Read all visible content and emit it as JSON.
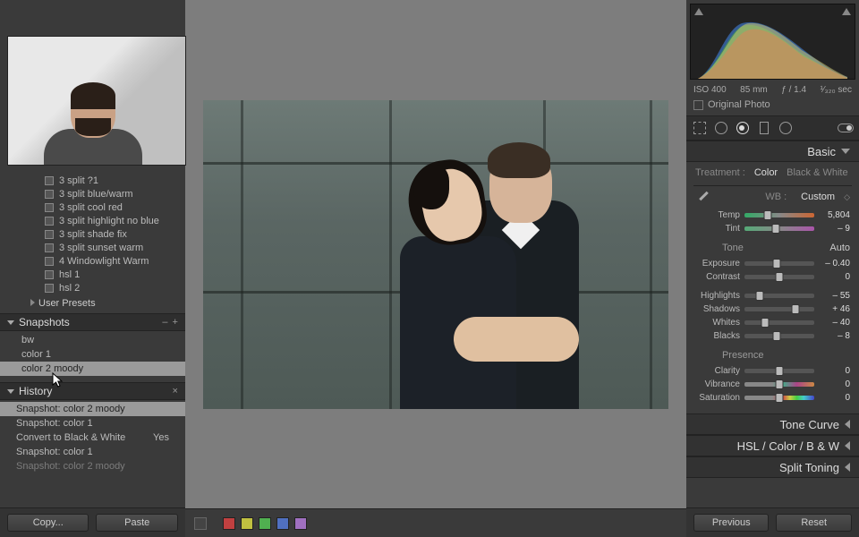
{
  "left": {
    "presets": [
      "3 split ?1",
      "3 split blue/warm",
      "3 split cool red",
      "3 split highlight no blue",
      "3 split shade fix",
      "3 split sunset warm",
      "4 Windowlight Warm",
      "hsl 1",
      "hsl 2"
    ],
    "userPresets": "User Presets",
    "snapshotsHeader": "Snapshots",
    "snapshots": [
      {
        "label": "bw",
        "selected": false
      },
      {
        "label": "color 1",
        "selected": false
      },
      {
        "label": "color 2 moody",
        "selected": true
      }
    ],
    "historyHeader": "History",
    "history": [
      {
        "label": "Snapshot: color 2 moody",
        "val": "",
        "selected": true
      },
      {
        "label": "Snapshot: color 1",
        "val": "",
        "selected": false
      },
      {
        "label": "Convert to Black & White",
        "val": "Yes",
        "selected": false
      },
      {
        "label": "Snapshot: color 1",
        "val": "",
        "selected": false
      },
      {
        "label": "Snapshot: color 2 moody",
        "val": "",
        "selected": false
      }
    ],
    "copy": "Copy...",
    "paste": "Paste"
  },
  "center": {
    "colors": [
      "#c04040",
      "#c0c040",
      "#50b050",
      "#50b0b0",
      "#5070c0",
      "#a070c0"
    ]
  },
  "right": {
    "exif": {
      "iso": "ISO 400",
      "fl": "85 mm",
      "ap": "ƒ / 1.4",
      "ss": "¹⁄₃₂₀ sec"
    },
    "originalPhoto": "Original Photo",
    "basic": "Basic",
    "treatment": {
      "label": "Treatment :",
      "color": "Color",
      "bw": "Black & White"
    },
    "wb": {
      "label": "WB :",
      "value": "Custom"
    },
    "temp": {
      "name": "Temp",
      "value": "5,804",
      "pos": 33
    },
    "tint": {
      "name": "Tint",
      "value": "– 9",
      "pos": 45
    },
    "toneHdr": "Tone",
    "autoLabel": "Auto",
    "exposure": {
      "name": "Exposure",
      "value": "– 0.40",
      "pos": 46
    },
    "contrast": {
      "name": "Contrast",
      "value": "0",
      "pos": 50
    },
    "highlights": {
      "name": "Highlights",
      "value": "– 55",
      "pos": 22
    },
    "shadows": {
      "name": "Shadows",
      "value": "+ 46",
      "pos": 73
    },
    "whites": {
      "name": "Whites",
      "value": "– 40",
      "pos": 30
    },
    "blacks": {
      "name": "Blacks",
      "value": "– 8",
      "pos": 46
    },
    "presenceHdr": "Presence",
    "clarity": {
      "name": "Clarity",
      "value": "0",
      "pos": 50
    },
    "vibrance": {
      "name": "Vibrance",
      "value": "0",
      "pos": 50
    },
    "saturation": {
      "name": "Saturation",
      "value": "0",
      "pos": 50
    },
    "closed": [
      "Tone Curve",
      "HSL  /  Color  /  B & W",
      "Split Toning"
    ],
    "previous": "Previous",
    "reset": "Reset"
  }
}
